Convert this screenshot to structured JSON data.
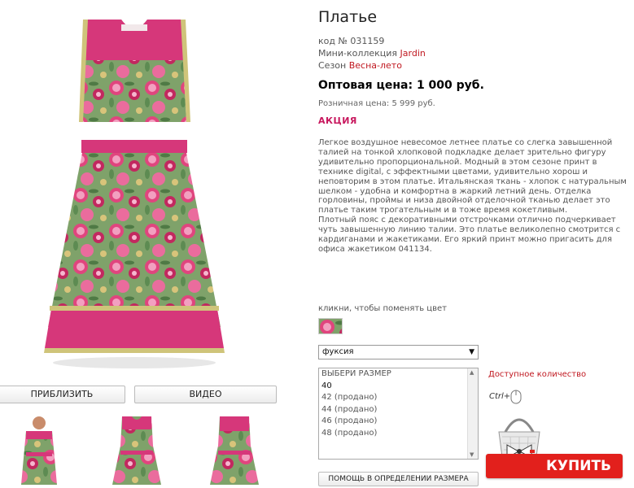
{
  "product": {
    "title": "Платье",
    "code_label": "код № ",
    "code": "031159",
    "collection_label": "Мини-коллекция ",
    "collection": "Jardin",
    "season_label": "Сезон ",
    "season": "Весна-лето",
    "wholesale_price": "Оптовая цена: 1 000 руб.",
    "retail_price": "Розничная цена: 5 999 руб.",
    "promo": "АКЦИЯ",
    "description_1": "Легкое воздушное невесомое летнее платье со слегка завышенной талией  на тонкой хлопковой подкладке делает зрительно фигуру удивительно пропорциональной. Модный в этом сезоне принт в технике digital, с эффектными цветами, удивительно хорош и неповторим в этом платье.   Итальянская ткань - хлопок с натуральным шелком - удобна и комфортна в жаркий летний день. Отделка горловины, проймы и низа двойной отделочной тканью делает это платье таким трогательным и в тоже время  кокетливым.",
    "description_2": "Плотный пояс с декоративными отстрочками отлично подчеркивает чуть завышенную линию талии. Это платье великолепно смотрится с кардиганами и жакетиками. Его яркий принт можно пригасить для офиса жакетиком 041134."
  },
  "gallery": {
    "zoom_label": "ПРИБЛИЗИТЬ",
    "video_label": "ВИДЕО"
  },
  "color": {
    "hint": "кликни, чтобы поменять цвет",
    "selected": "фуксия"
  },
  "sizes": {
    "header": "ВЫБЕРИ РАЗМЕР",
    "options": [
      "40",
      "42 (продано)",
      "44 (продано)",
      "46 (продано)",
      "48 (продано)"
    ]
  },
  "actions": {
    "size_help": "ПОМОЩЬ В ОПРЕДЕЛЕНИИ РАЗМЕРА",
    "availability": "Доступное количество",
    "ctrl_hint": "Ctrl+",
    "buy": "КУПИТЬ"
  },
  "colors": {
    "accent": "#e2201c",
    "link": "#c01820",
    "promo": "#c8185e",
    "fuchsia": "#d62f7b"
  }
}
